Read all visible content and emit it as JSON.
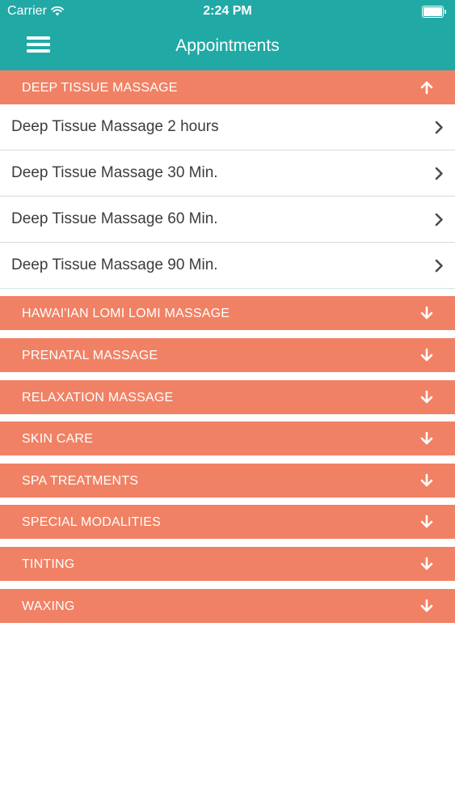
{
  "status_bar": {
    "carrier": "Carrier",
    "time": "2:24 PM"
  },
  "nav": {
    "title": "Appointments",
    "menu_icon": "hamburger-menu-icon"
  },
  "expanded_category": {
    "label": "DEEP TISSUE MASSAGE",
    "icon": "arrow-up-icon",
    "services": [
      {
        "label": "Deep Tissue Massage 2 hours"
      },
      {
        "label": "Deep Tissue Massage 30 Min."
      },
      {
        "label": "Deep Tissue Massage 60 Min."
      },
      {
        "label": "Deep Tissue Massage 90 Min."
      }
    ]
  },
  "collapsed_categories": [
    {
      "label": "HAWAI'IAN LOMI LOMI MASSAGE"
    },
    {
      "label": "PRENATAL MASSAGE"
    },
    {
      "label": "RELAXATION MASSAGE"
    },
    {
      "label": "SKIN CARE"
    },
    {
      "label": "SPA TREATMENTS"
    },
    {
      "label": "SPECIAL MODALITIES"
    },
    {
      "label": "TINTING"
    },
    {
      "label": "WAXING"
    }
  ],
  "colors": {
    "header": "#21a9a6",
    "category": "#f18164",
    "row_text": "#3c3c3c"
  }
}
